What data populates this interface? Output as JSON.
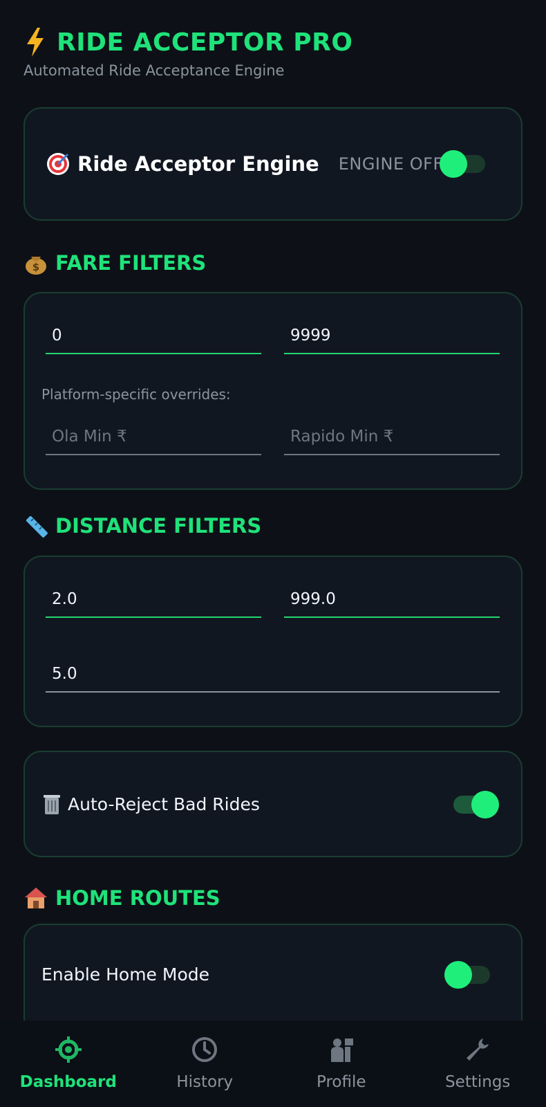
{
  "header": {
    "title": "RIDE ACCEPTOR PRO",
    "subtitle": "Automated Ride Acceptance Engine"
  },
  "engine": {
    "label": "Ride Acceptor Engine",
    "status": "ENGINE OFF",
    "enabled": false
  },
  "fare_filters": {
    "title": "FARE FILTERS",
    "min_fare": "0",
    "max_fare": "9999",
    "overrides_hint": "Platform-specific overrides:",
    "ola_placeholder": "Ola Min ₹",
    "rapido_placeholder": "Rapido Min ₹"
  },
  "distance_filters": {
    "title": "DISTANCE FILTERS",
    "min_distance": "2.0",
    "max_distance": "999.0",
    "pickup_distance": "5.0"
  },
  "auto_reject": {
    "label": "Auto-Reject Bad Rides",
    "enabled": true
  },
  "home_routes": {
    "title": "HOME ROUTES",
    "enable_label": "Enable Home Mode",
    "enabled": false
  },
  "navbar": {
    "items": [
      {
        "label": "Dashboard",
        "icon": "crosshair-icon",
        "active": true
      },
      {
        "label": "History",
        "icon": "clock-icon",
        "active": false
      },
      {
        "label": "Profile",
        "icon": "person-icon",
        "active": false
      },
      {
        "label": "Settings",
        "icon": "wrench-icon",
        "active": false
      }
    ]
  },
  "colors": {
    "accent": "#1fe27a",
    "background": "#0d1117",
    "card_border": "#193e30"
  }
}
